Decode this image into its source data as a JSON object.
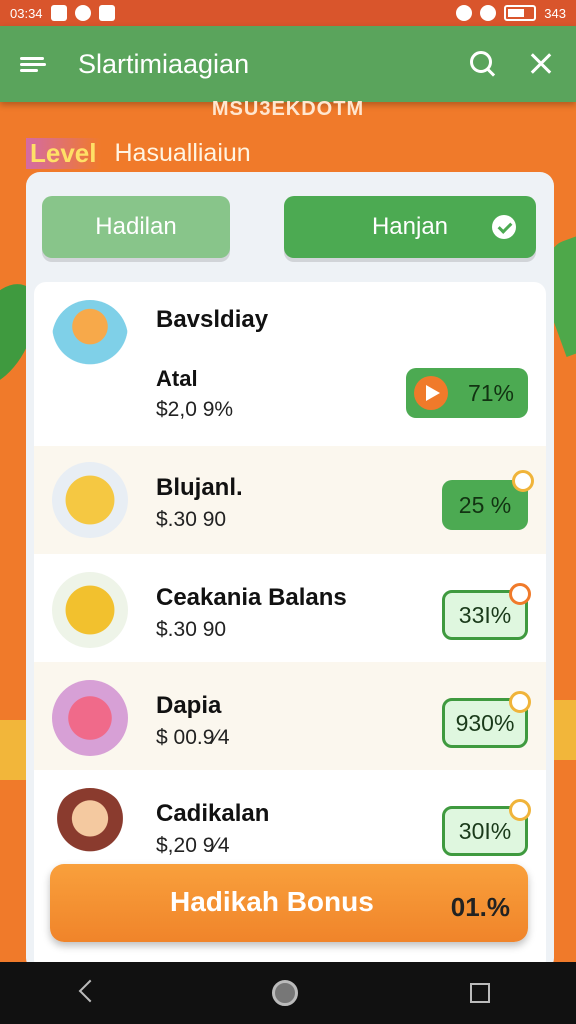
{
  "status_bar": {
    "time": "03:34",
    "right_text": "343"
  },
  "appbar": {
    "title": "Slartimiaagian"
  },
  "subheading": "MSU3EKDOTM",
  "level": {
    "badge": "Level",
    "text": "Hasualliaiun"
  },
  "tabs": [
    {
      "label": "Hadilan"
    },
    {
      "label": "Hanjan"
    }
  ],
  "items": [
    {
      "title": "Bavsldiay",
      "subtitle": "Atal",
      "price": "$2,0 9%",
      "percent": "71%"
    },
    {
      "title": "Blujanl.",
      "price": "$.30 90",
      "percent": "25 %"
    },
    {
      "title": "Ceakania Balans",
      "price": "$.30 90",
      "percent": "33I%"
    },
    {
      "title": "Dapia",
      "price": "$ 00.9⁄4",
      "percent": "930%"
    },
    {
      "title": "Cadikalan",
      "price": "$,20 9⁄4",
      "percent": "30I%"
    }
  ],
  "bonus": {
    "label": "Hadikah Bonus",
    "value": "01.%"
  },
  "colors": {
    "primary_green": "#5aa45c",
    "accent_orange": "#f07a2a",
    "status_bar": "#d9552c"
  }
}
